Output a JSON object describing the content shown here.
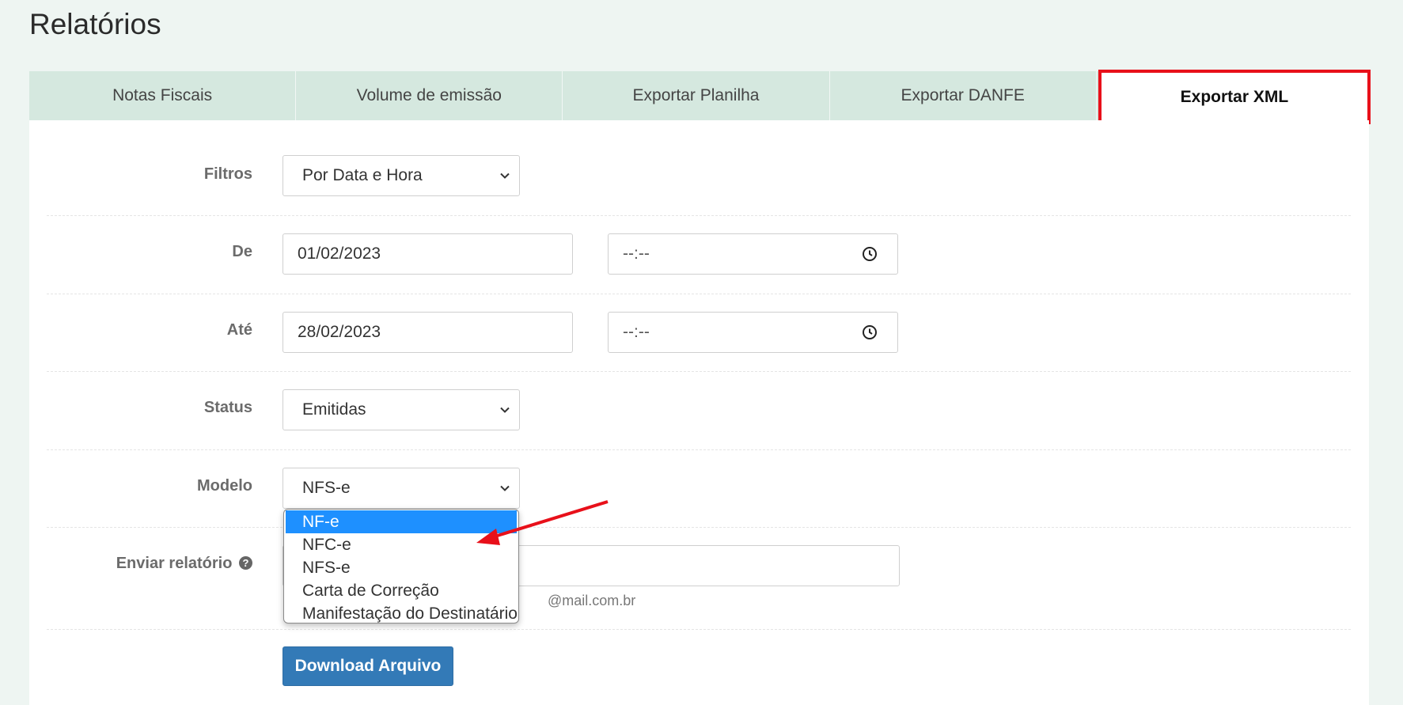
{
  "page": {
    "title": "Relatórios"
  },
  "tabs": [
    {
      "label": "Notas Fiscais",
      "active": false
    },
    {
      "label": "Volume de emissão",
      "active": false
    },
    {
      "label": "Exportar Planilha",
      "active": false
    },
    {
      "label": "Exportar DANFE",
      "active": false
    },
    {
      "label": "Exportar XML",
      "active": true
    }
  ],
  "form": {
    "filtros": {
      "label": "Filtros",
      "value": "Por Data e Hora"
    },
    "de": {
      "label": "De",
      "date": "01/02/2023",
      "time": "--:--"
    },
    "ate": {
      "label": "Até",
      "date": "28/02/2023",
      "time": "--:--"
    },
    "status": {
      "label": "Status",
      "value": "Emitidas"
    },
    "modelo": {
      "label": "Modelo",
      "value": "NFS-e",
      "options": [
        "NF-e",
        "NFC-e",
        "NFS-e",
        "Carta de Correção",
        "Manifestação do Destinatário"
      ],
      "highlighted": "NF-e"
    },
    "enviar": {
      "label": "Enviar relatório",
      "hint": "@mail.com.br",
      "value": ""
    },
    "download_label": "Download Arquivo"
  },
  "colors": {
    "tab_bg": "#d5e8df",
    "active_border": "#e8101a",
    "button": "#337ab7",
    "option_highlight": "#1e90ff",
    "annotation_arrow": "#e8101a"
  }
}
